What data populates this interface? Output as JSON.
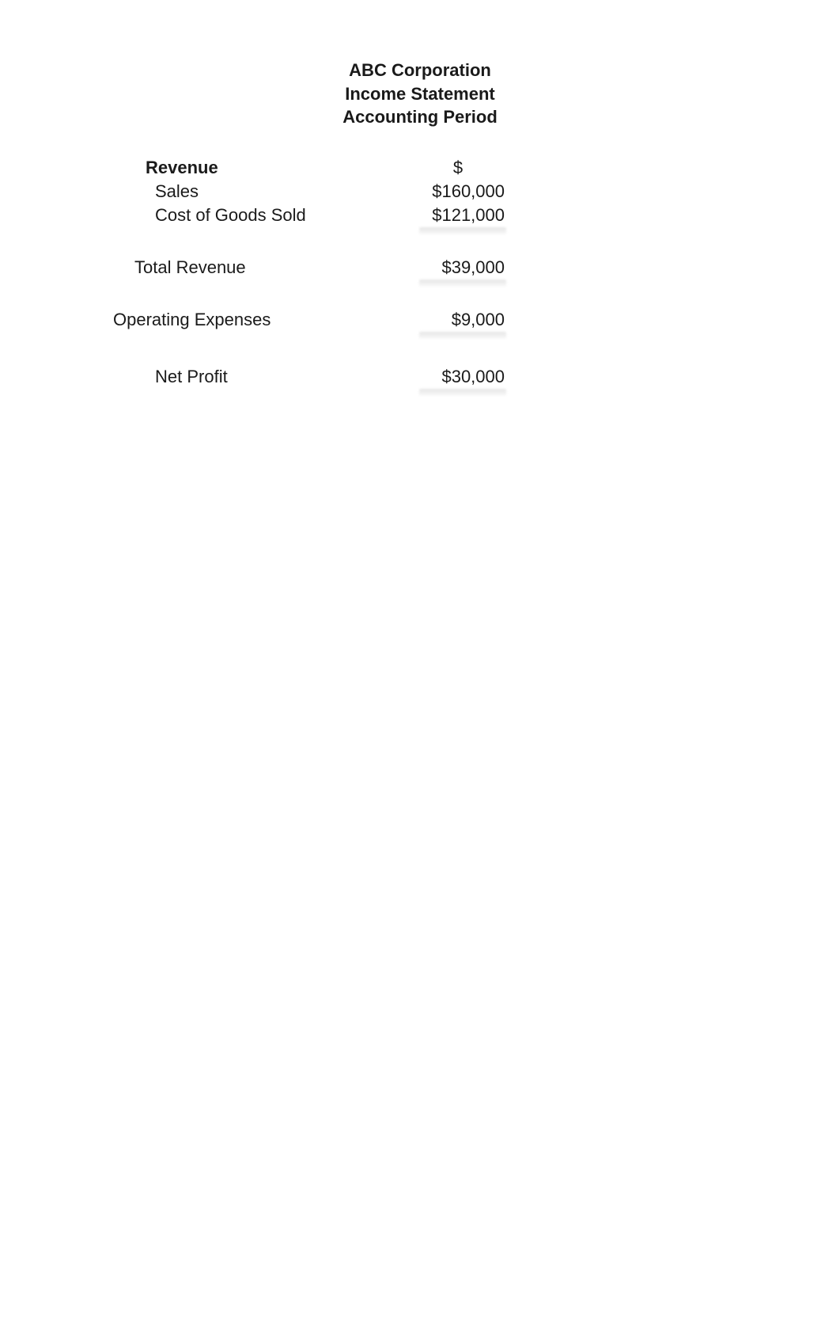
{
  "header": {
    "company": "ABC Corporation",
    "title": "Income Statement",
    "period": "Accounting Period"
  },
  "columns": {
    "currency_symbol": "$"
  },
  "revenue": {
    "label": "Revenue",
    "items": {
      "sales": {
        "label": "Sales",
        "value": "$160,000"
      },
      "cogs": {
        "label": "Cost of Goods Sold",
        "value": "$121,000"
      }
    }
  },
  "total_revenue": {
    "label": "Total Revenue",
    "value": "$39,000"
  },
  "operating_expenses": {
    "label": "Operating Expenses",
    "value": "$9,000"
  },
  "net_profit": {
    "label": "Net Profit",
    "value": "$30,000"
  }
}
